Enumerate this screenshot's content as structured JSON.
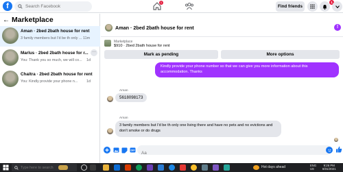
{
  "topbar": {
    "logo": "f",
    "search_placeholder": "Search Facebook",
    "home_badge": "1",
    "find_friends_label": "Find friends",
    "notif_badge": "1"
  },
  "sidebar": {
    "title": "Marketplace",
    "conversations": [
      {
        "title": "Aman · 2bed 2bath house for rent",
        "preview": "3 family members but I'd be th only ...",
        "ago": "11m"
      },
      {
        "title": "Marlus · 2bed 2bath house for r...",
        "preview": "You: Thank you so much, we will co...",
        "ago": "1d"
      },
      {
        "title": "Chaitra · 2bed 2bath house for rent",
        "preview": "You: Kindly provide your phone n...",
        "ago": "1d"
      }
    ]
  },
  "chat": {
    "header_title": "Aman · 2bed 2bath house for rent",
    "menu_icon": "!",
    "listing_source": "Marketplace",
    "listing_price_title": "$910 · 2bed 2bath house for rent",
    "mark_pending_label": "Mark as pending",
    "more_options_label": "More options",
    "outgoing_message": "Kindly provide your phone number so that we can give you more information about this accommodation. Thanks",
    "sender_name": "Aman",
    "incoming_1": "5618098173",
    "incoming_2": "3 family members but I'd be th only one living there and have no pets and no evictions and don't smoke or do drugs",
    "composer_placeholder": "Aa"
  },
  "taskbar": {
    "search_placeholder": "Type here to search",
    "tray_text": "Hot days ahead",
    "lang_line1": "ENG",
    "lang_line2": "US",
    "time": "9:26 PM",
    "date": "8/31/2021"
  },
  "colors": {
    "facebook_blue": "#1877f2",
    "message_purple": "#a033ff",
    "badge_red": "#e41e3f"
  }
}
